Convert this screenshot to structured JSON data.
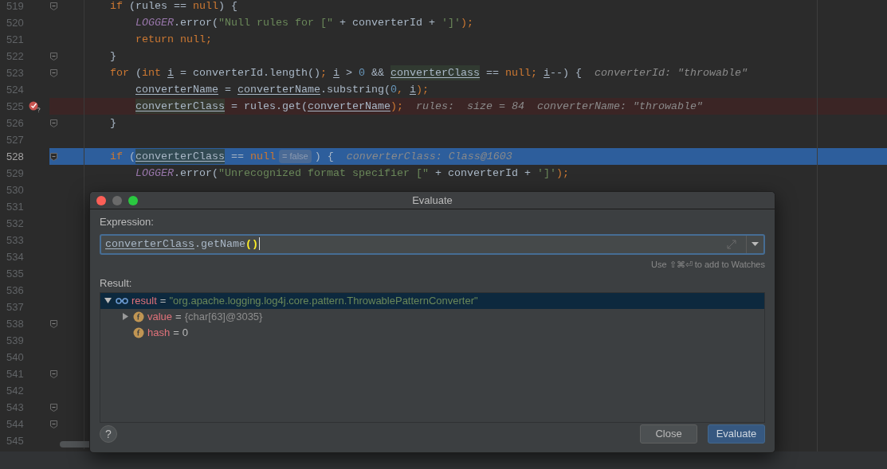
{
  "editor": {
    "lines": [
      {
        "number": "519",
        "fold": true,
        "kind": "normal",
        "tokens": [
          {
            "text": "if ",
            "kind": "keyword"
          },
          {
            "text": "(rules == ",
            "kind": "plain"
          },
          {
            "text": "null",
            "kind": "keyword"
          },
          {
            "text": ") {",
            "kind": "plain"
          }
        ],
        "children": [
          {
            "number": "520",
            "fold": false,
            "kind": "normal",
            "tokens": [
              {
                "text": "LOGGER",
                "kind": "static"
              },
              {
                "text": ".error(",
                "kind": "plain"
              },
              {
                "text": "\"Null rules for [\"",
                "kind": "string"
              },
              {
                "text": " + converterId + ",
                "kind": "plain"
              },
              {
                "text": "']'",
                "kind": "string"
              },
              {
                "text": ");",
                "kind": "keyword"
              }
            ]
          },
          {
            "number": "521",
            "fold": false,
            "kind": "normal",
            "tokens": [
              {
                "text": "return null;",
                "kind": "keyword"
              }
            ]
          }
        ]
      },
      {
        "number": "522",
        "fold": true,
        "kind": "normal",
        "tokens": [
          {
            "text": "}",
            "kind": "plain"
          }
        ]
      },
      {
        "number": "523",
        "fold": true,
        "kind": "normal",
        "tokens": [
          {
            "text": "for ",
            "kind": "keyword"
          },
          {
            "text": "(",
            "kind": "plain"
          },
          {
            "text": "int ",
            "kind": "keyword"
          },
          {
            "text": "i",
            "kind": "local"
          },
          {
            "text": " = converterId.length()",
            "kind": "plain"
          },
          {
            "text": "; ",
            "kind": "keyword"
          },
          {
            "text": "i",
            "kind": "local"
          },
          {
            "text": " > ",
            "kind": "plain"
          },
          {
            "text": "0",
            "kind": "number"
          },
          {
            "text": " && ",
            "kind": "plain"
          },
          {
            "text": "converterClass",
            "kind": "local_marked"
          },
          {
            "text": " == ",
            "kind": "plain"
          },
          {
            "text": "null; ",
            "kind": "keyword"
          },
          {
            "text": "i",
            "kind": "local"
          },
          {
            "text": "--) {",
            "kind": "plain"
          },
          {
            "text": "converterId: \"throwable\"",
            "kind": "hint"
          }
        ],
        "children": [
          {
            "number": "524",
            "fold": false,
            "kind": "normal",
            "tokens": [
              {
                "text": "converterName",
                "kind": "local"
              },
              {
                "text": " = ",
                "kind": "plain"
              },
              {
                "text": "converterName",
                "kind": "local"
              },
              {
                "text": ".substring(",
                "kind": "plain"
              },
              {
                "text": "0",
                "kind": "number"
              },
              {
                "text": ", ",
                "kind": "keyword"
              },
              {
                "text": "i",
                "kind": "local"
              },
              {
                "text": ");",
                "kind": "keyword"
              }
            ]
          },
          {
            "number": "525",
            "fold": false,
            "kind": "breakpoint",
            "tokens": [
              {
                "text": "converterClass",
                "kind": "local_marked"
              },
              {
                "text": " = rules.get(",
                "kind": "plain"
              },
              {
                "text": "converterName",
                "kind": "local"
              },
              {
                "text": ");",
                "kind": "keyword"
              },
              {
                "text": "rules:  size = 84  converterName: \"throwable\"",
                "kind": "hint"
              }
            ]
          }
        ]
      },
      {
        "number": "526",
        "fold": true,
        "kind": "normal",
        "tokens": [
          {
            "text": "}",
            "kind": "plain"
          }
        ]
      },
      {
        "number": "527",
        "fold": false,
        "kind": "normal"
      },
      {
        "number": "528",
        "fold": true,
        "kind": "execution",
        "tokens": [
          {
            "text": "if ",
            "kind": "keyword"
          },
          {
            "text": "(",
            "kind": "plain"
          },
          {
            "text": "converterClass",
            "kind": "local_marked"
          },
          {
            "text": " == ",
            "kind": "plain"
          },
          {
            "text": "null",
            "kind": "keyword"
          },
          {
            "text": "= false",
            "kind": "inline_value"
          },
          {
            "text": ") {",
            "kind": "plain"
          },
          {
            "text": "converterClass: Class@1603",
            "kind": "hint"
          }
        ],
        "children": [
          {
            "number": "529",
            "fold": false,
            "kind": "normal",
            "tokens": [
              {
                "text": "LOGGER",
                "kind": "static"
              },
              {
                "text": ".error(",
                "kind": "plain"
              },
              {
                "text": "\"Unrecognized format specifier [\"",
                "kind": "string"
              },
              {
                "text": " + converterId + ",
                "kind": "plain"
              },
              {
                "text": "']'",
                "kind": "string"
              },
              {
                "text": ");",
                "kind": "keyword"
              }
            ]
          },
          {
            "number": "530",
            "fold": false,
            "kind": "normal"
          }
        ]
      },
      {
        "number": "531",
        "fold": false,
        "kind": "normal"
      },
      {
        "number": "532",
        "fold": false,
        "kind": "normal"
      },
      {
        "number": "533",
        "fold": false,
        "kind": "normal"
      },
      {
        "number": "534",
        "fold": false,
        "kind": "normal"
      },
      {
        "number": "535",
        "fold": false,
        "kind": "normal"
      },
      {
        "number": "536",
        "fold": false,
        "kind": "normal"
      },
      {
        "number": "537",
        "fold": false,
        "kind": "normal"
      },
      {
        "number": "538",
        "fold": true,
        "kind": "normal"
      },
      {
        "number": "539",
        "fold": false,
        "kind": "normal"
      },
      {
        "number": "540",
        "fold": false,
        "kind": "normal"
      },
      {
        "number": "541",
        "fold": true,
        "kind": "normal"
      },
      {
        "number": "542",
        "fold": false,
        "kind": "normal"
      },
      {
        "number": "543",
        "fold": true,
        "kind": "normal"
      },
      {
        "number": "544",
        "fold": true,
        "kind": "normal"
      },
      {
        "number": "545",
        "fold": false,
        "kind": "normal"
      }
    ]
  },
  "dialog": {
    "title": "Evaluate",
    "expression_label": "Expression:",
    "expression": [
      {
        "text": "converterClass",
        "kind": "local"
      },
      {
        "text": ".getName",
        "kind": "plain"
      },
      {
        "text": "()",
        "kind": "paren_match"
      }
    ],
    "watch_hint": "Use ⇧⌘⏎ to add to Watches",
    "result_label": "Result:",
    "result_tree": [
      {
        "name": "result",
        "equals": "=",
        "value": {
          "text": "\"org.apache.logging.log4j.core.pattern.ThrowablePatternConverter\"",
          "kind": "string"
        },
        "kind": "watch",
        "selected": true,
        "expanded": true,
        "children": [
          {
            "name": "value",
            "equals": "=",
            "value": {
              "text": "{char[63]@3035}",
              "kind": "object"
            },
            "kind": "field",
            "selected": false,
            "expanded": false
          },
          {
            "name": "hash",
            "equals": "=",
            "value": {
              "text": "0",
              "kind": "number"
            },
            "kind": "field",
            "selected": false
          }
        ]
      }
    ],
    "help": "?",
    "buttons": [
      {
        "label": "Close",
        "kind": "secondary"
      },
      {
        "label": "Evaluate",
        "kind": "primary"
      }
    ]
  }
}
